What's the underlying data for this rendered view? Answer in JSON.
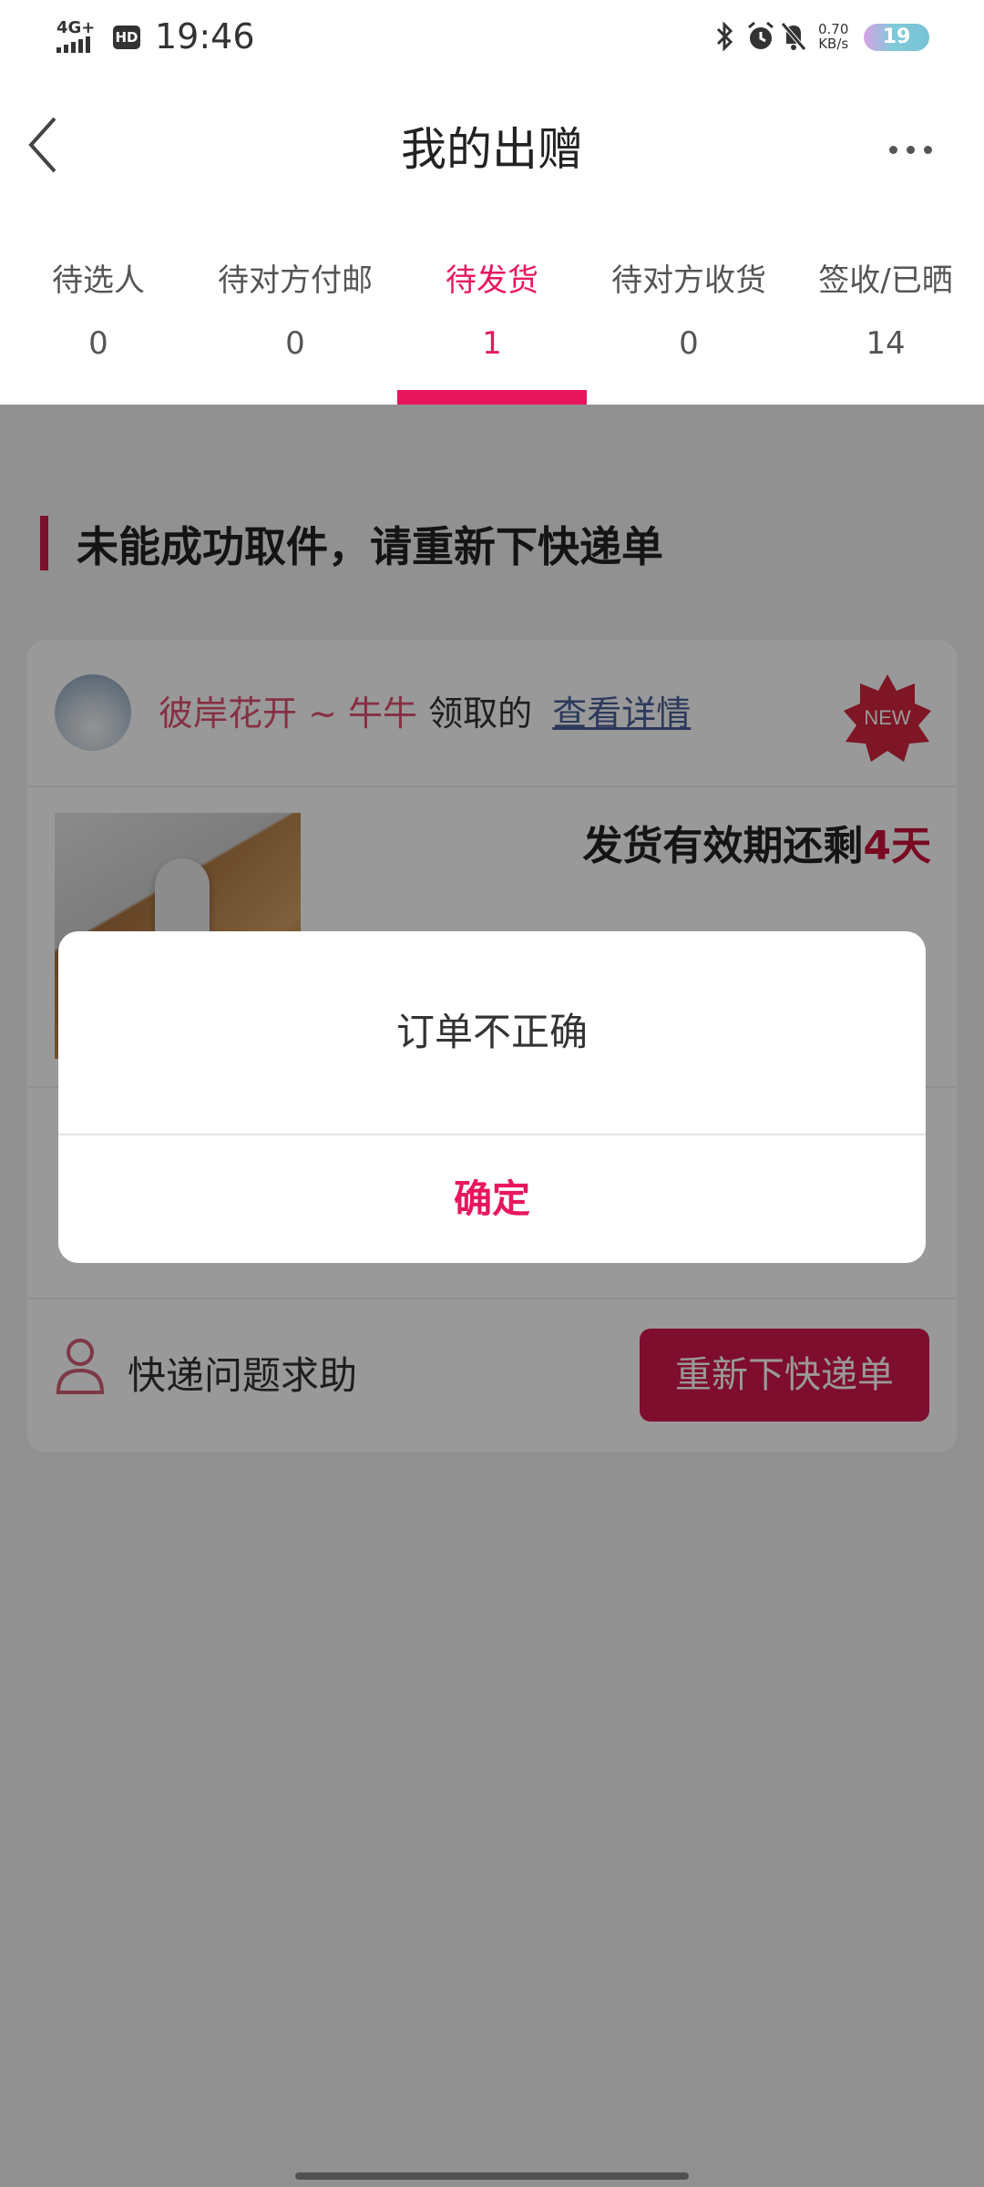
{
  "status_bar": {
    "network": "4G+",
    "hd": "HD",
    "time": "19:46",
    "speed_value": "0.70",
    "speed_unit": "KB/s",
    "battery": "19"
  },
  "header": {
    "title": "我的出赠"
  },
  "tabs": [
    {
      "label": "待选人",
      "count": "0"
    },
    {
      "label": "待对方付邮",
      "count": "0"
    },
    {
      "label": "待发货",
      "count": "1"
    },
    {
      "label": "待对方收货",
      "count": "0"
    },
    {
      "label": "签收/已晒",
      "count": "14"
    }
  ],
  "section": {
    "title": "未能成功取件，请重新下快递单"
  },
  "order_card": {
    "receiver_name": "彼岸花开 ~ 牛牛",
    "receiver_verb": "领取的",
    "details_link": "查看详情",
    "badge": "NEW",
    "deadline_prefix": "发货有效期还剩",
    "deadline_value": "4天",
    "help_label": "快递问题求助",
    "reorder_button": "重新下快递单"
  },
  "dialog": {
    "message": "订单不正确",
    "confirm": "确定"
  },
  "colors": {
    "accent": "#e8175d",
    "button": "#d4174d",
    "overlay": "rgba(0,0,0,0.40)"
  }
}
